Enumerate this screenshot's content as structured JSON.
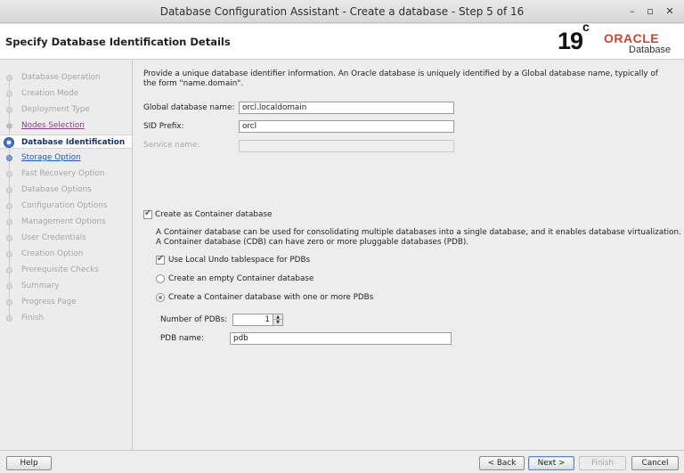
{
  "window": {
    "title": "Database Configuration Assistant - Create a database - Step 5 of 16",
    "minimize_glyph": "–",
    "maximize_glyph": "▫",
    "close_glyph": "✕"
  },
  "header": {
    "page_title": "Specify Database Identification Details",
    "logo_version": "19",
    "logo_version_sup": "c",
    "logo_brand": "ORACLE",
    "logo_product": "Database",
    "brand_color": "#c74634"
  },
  "nav": {
    "items": [
      {
        "label": "Database Operation",
        "state": "done"
      },
      {
        "label": "Creation Mode",
        "state": "done"
      },
      {
        "label": "Deployment Type",
        "state": "done"
      },
      {
        "label": "Nodes Selection",
        "state": "visited"
      },
      {
        "label": "Database Identification",
        "state": "current"
      },
      {
        "label": "Storage Option",
        "state": "link"
      },
      {
        "label": "Fast Recovery Option",
        "state": "pending"
      },
      {
        "label": "Database Options",
        "state": "pending"
      },
      {
        "label": "Configuration Options",
        "state": "pending"
      },
      {
        "label": "Management Options",
        "state": "pending"
      },
      {
        "label": "User Credentials",
        "state": "pending"
      },
      {
        "label": "Creation Option",
        "state": "pending"
      },
      {
        "label": "Prerequisite Checks",
        "state": "pending"
      },
      {
        "label": "Summary",
        "state": "pending"
      },
      {
        "label": "Progress Page",
        "state": "pending"
      },
      {
        "label": "Finish",
        "state": "pending"
      }
    ]
  },
  "main": {
    "description": "Provide a unique database identifier information. An Oracle database is uniquely identified by a Global database name, typically of the form \"name.domain\".",
    "global_db_name_label": "Global database name:",
    "global_db_name_value": "orcl.localdomain",
    "sid_prefix_label": "SID Prefix:",
    "sid_prefix_value": "orcl",
    "service_name_label": "Service name:",
    "service_name_value": "",
    "container_checkbox_label": "Create as Container database",
    "container_checked": true,
    "container_desc_1": "A Container database can be used for consolidating multiple databases into a single database, and it enables database virtualization.",
    "container_desc_2": "A Container database (CDB) can have zero or more pluggable databases (PDB).",
    "local_undo_label": "Use Local Undo tablespace for PDBs",
    "local_undo_checked": true,
    "radio_empty_label": "Create an empty Container database",
    "radio_pdbs_label": "Create a Container database with one or more PDBs",
    "selected_radio": "pdbs",
    "num_pdbs_label": "Number of PDBs:",
    "num_pdbs_value": "1",
    "pdb_name_label": "PDB name:",
    "pdb_name_value": "pdb"
  },
  "footer": {
    "help": "Help",
    "back": "< Back",
    "next": "Next >",
    "finish": "Finish",
    "cancel": "Cancel"
  }
}
